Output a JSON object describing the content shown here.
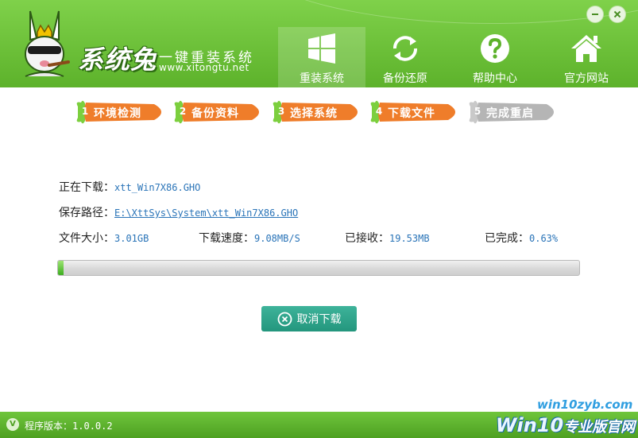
{
  "header": {
    "logo_name": "系统兔",
    "slogan": "一键重装系统",
    "site": "www.xitongtu.net",
    "nav": [
      {
        "label": "重装系统",
        "icon": "windows-icon",
        "active": true
      },
      {
        "label": "备份还原",
        "icon": "refresh-icon"
      },
      {
        "label": "帮助中心",
        "icon": "help-icon"
      },
      {
        "label": "官方网站",
        "icon": "home-icon"
      }
    ]
  },
  "steps": [
    {
      "num": "1",
      "label": "环境检测",
      "state": "done"
    },
    {
      "num": "2",
      "label": "备份资料",
      "state": "done"
    },
    {
      "num": "3",
      "label": "选择系统",
      "state": "done"
    },
    {
      "num": "4",
      "label": "下载文件",
      "state": "current"
    },
    {
      "num": "5",
      "label": "完成重启",
      "state": "pending"
    }
  ],
  "download": {
    "file_label": "正在下载：",
    "file_value": "xtt_Win7X86.GHO",
    "path_label": "保存路径：",
    "path_value": "E:\\XttSys\\System\\xtt_Win7X86.GHO",
    "size_label": "文件大小：",
    "size_value": "3.01GB",
    "speed_label": "下载速度：",
    "speed_value": "9.08MB/S",
    "recv_label": "已接收：",
    "recv_value": "19.53MB",
    "done_label": "已完成：",
    "done_value": "0.63%",
    "progress_fraction": 0.0063
  },
  "cancel_label": "取消下载",
  "footer": {
    "version_label": "程序版本：",
    "version_value": "1.0.0.2"
  },
  "watermark": {
    "small": "win10zyb.com",
    "big_latin": "Win10",
    "big_cn": "专业版官网"
  },
  "colors": {
    "brand_green": "#5db22b",
    "step_orange": "#ef7d2a",
    "step_grey": "#b5b5b5",
    "value_blue": "#2a74b8",
    "button_teal": "#23967d"
  }
}
